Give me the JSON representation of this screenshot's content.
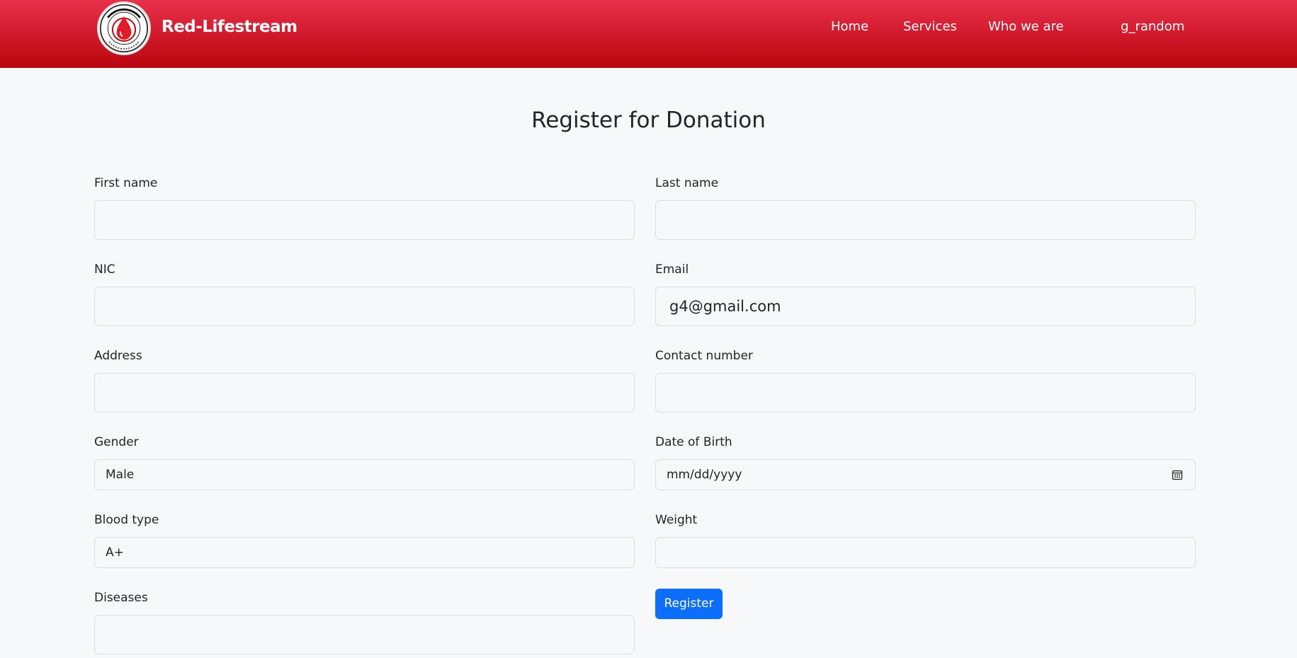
{
  "header": {
    "brand": "Red-Lifestream",
    "logo_text_top": "Red-Lifestream",
    "nav": {
      "home": "Home",
      "services": "Services",
      "who_we_are": "Who we are",
      "user": "g_random"
    },
    "colors": {
      "header_top": "#e8314a",
      "header_bottom": "#b8070f"
    }
  },
  "page": {
    "title": "Register for Donation"
  },
  "form": {
    "first_name": {
      "label": "First name",
      "value": ""
    },
    "last_name": {
      "label": "Last name",
      "value": ""
    },
    "nic": {
      "label": "NIC",
      "value": ""
    },
    "email": {
      "label": "Email",
      "value": "g4@gmail.com"
    },
    "address": {
      "label": "Address",
      "value": ""
    },
    "contact_number": {
      "label": "Contact number",
      "value": ""
    },
    "gender": {
      "label": "Gender",
      "selected": "Male"
    },
    "date_of_birth": {
      "label": "Date of Birth",
      "placeholder": "mm/dd/yyyy"
    },
    "blood_type": {
      "label": "Blood type",
      "selected": "A+"
    },
    "weight": {
      "label": "Weight",
      "value": ""
    },
    "diseases": {
      "label": "Diseases",
      "value": ""
    },
    "register_label": "Register",
    "colors": {
      "button": "#0d6efd"
    }
  }
}
